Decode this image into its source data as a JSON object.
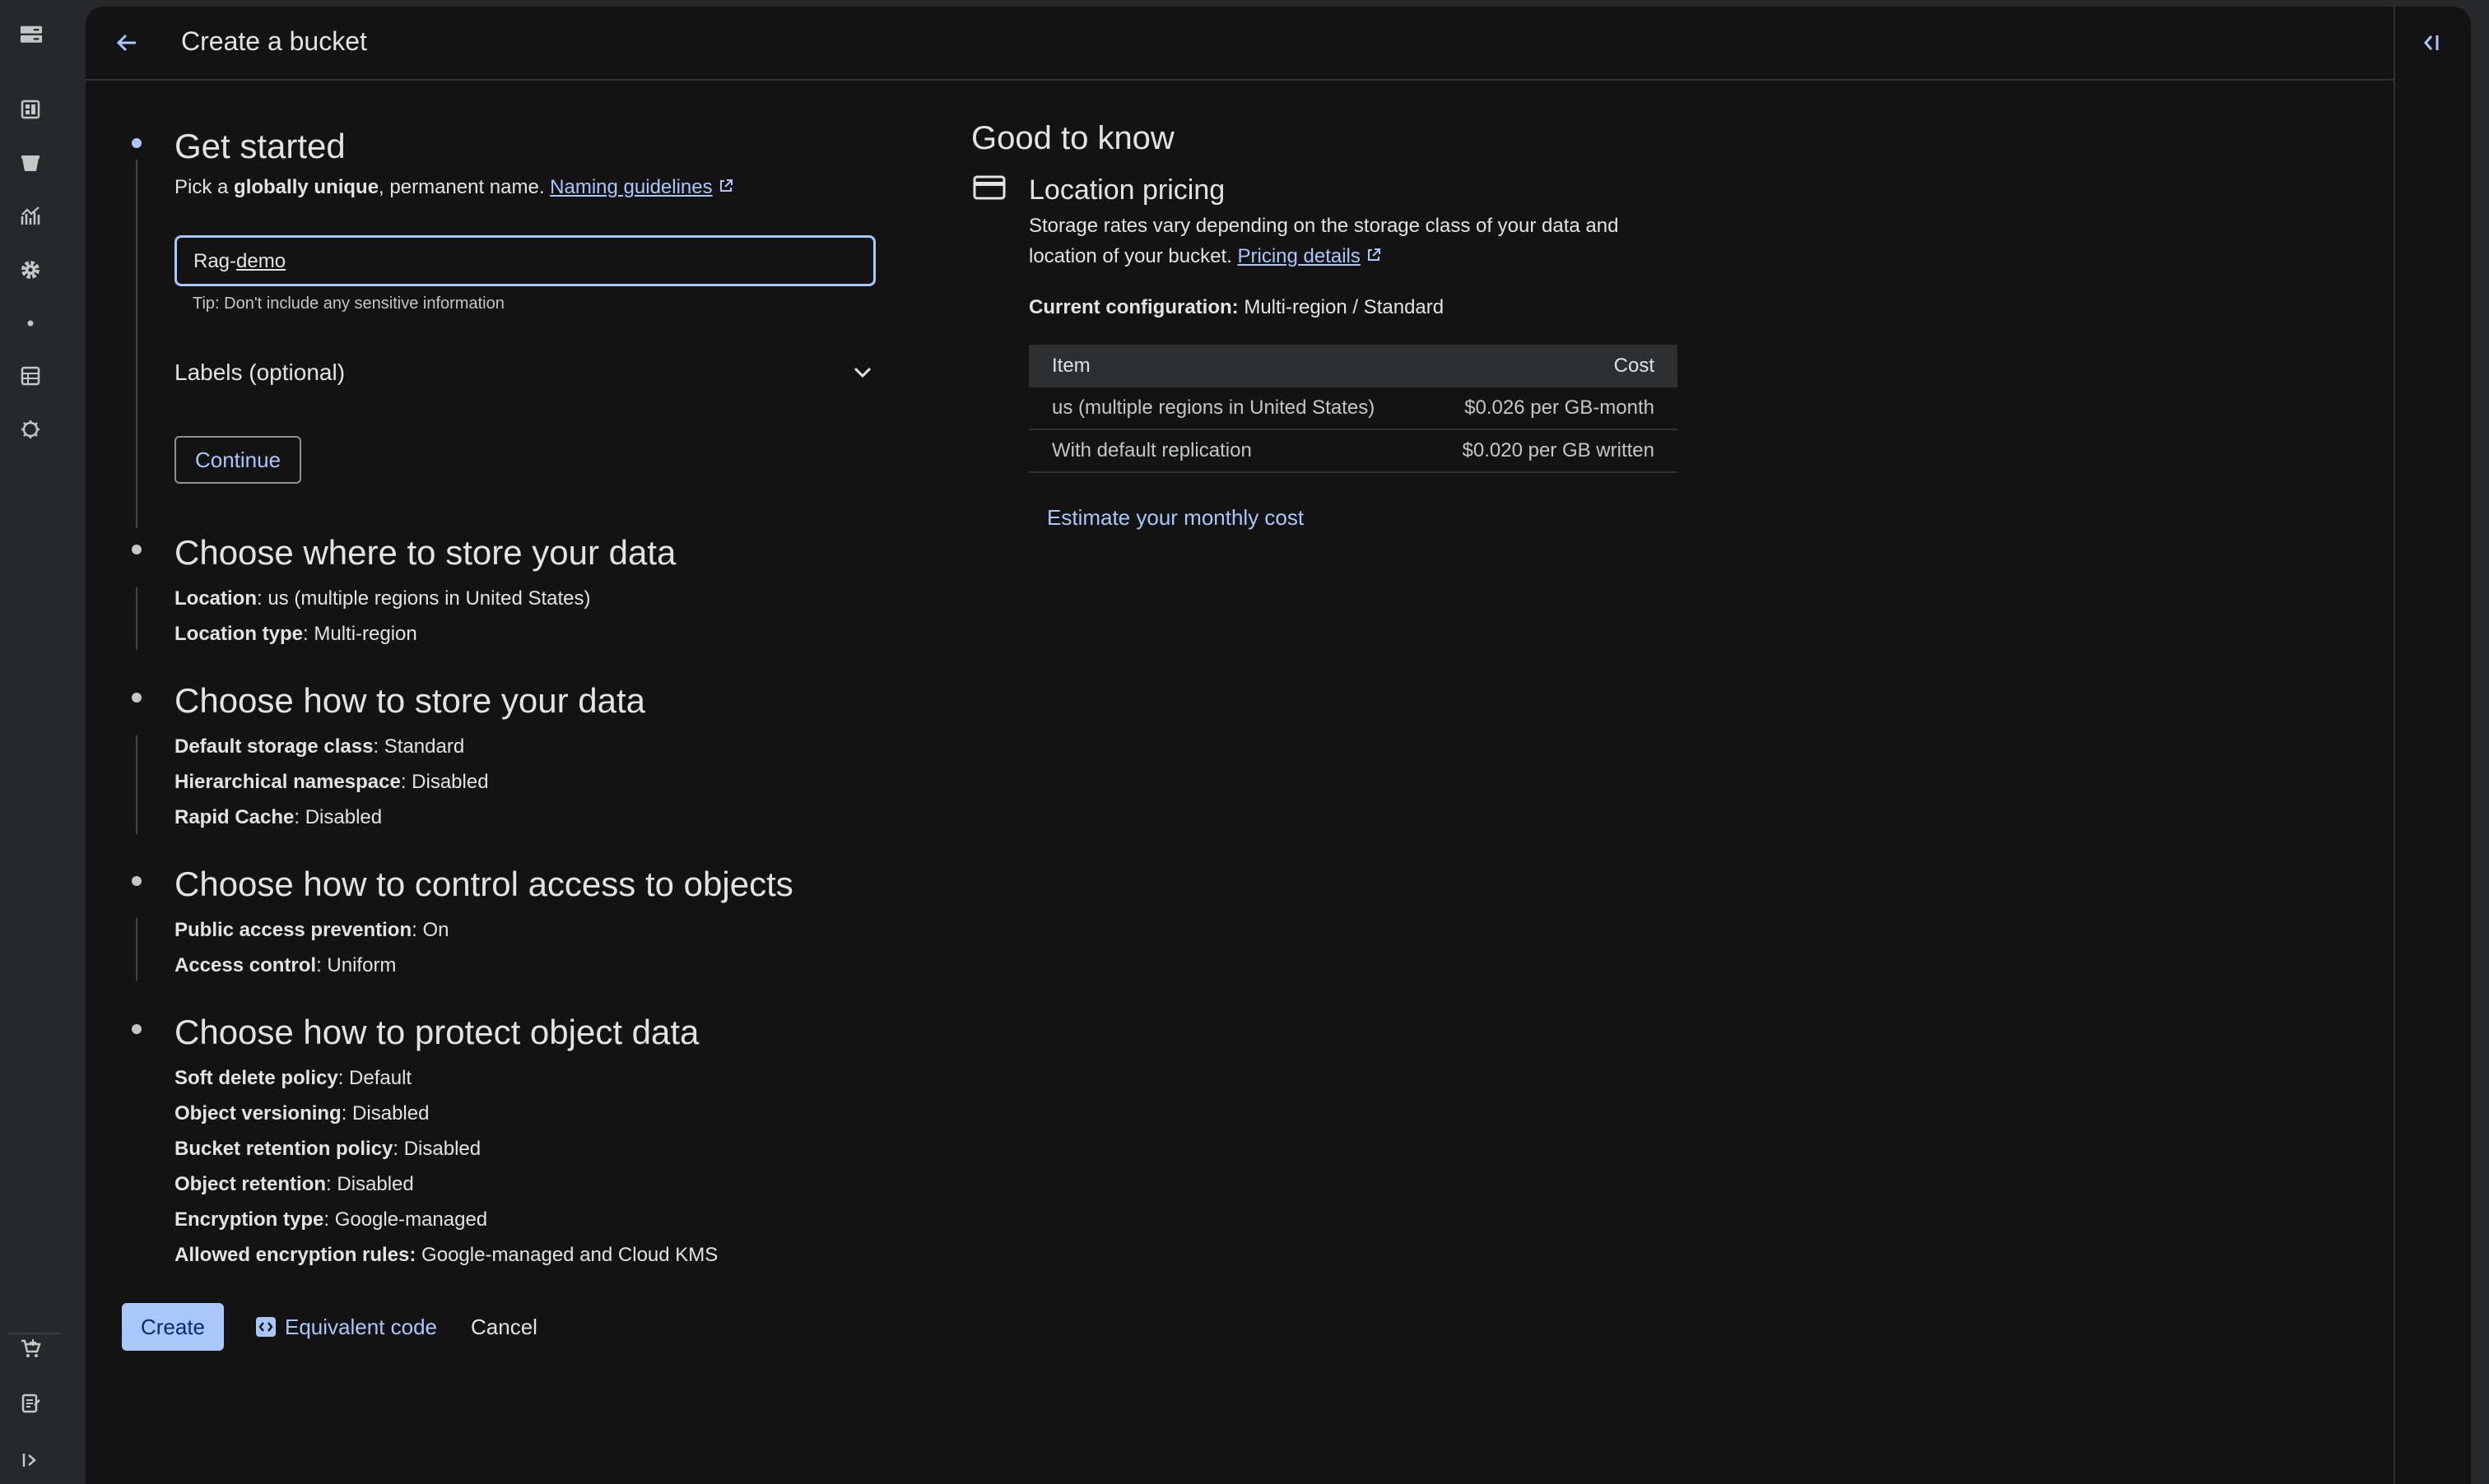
{
  "header": {
    "title": "Create a bucket"
  },
  "get_started": {
    "heading": "Get started",
    "desc_pre": "Pick a ",
    "desc_bold": "globally unique",
    "desc_post": ", permanent name. ",
    "naming_link": "Naming guidelines",
    "name_value_part1": "Rag-",
    "name_value_part2": "demo",
    "tip": "Tip: Don't include any sensitive information",
    "labels_toggle": "Labels (optional)",
    "continue_label": "Continue"
  },
  "where": {
    "heading": "Choose where to store your data",
    "location_label": "Location",
    "location_value": ": us (multiple regions in United States)",
    "type_label": "Location type",
    "type_value": ": Multi-region"
  },
  "how_store": {
    "heading": "Choose how to store your data",
    "class_label": "Default storage class",
    "class_value": ": Standard",
    "ns_label": "Hierarchical namespace",
    "ns_value": ": Disabled",
    "cache_label": "Rapid Cache",
    "cache_value": ": Disabled"
  },
  "access": {
    "heading": "Choose how to control access to objects",
    "pap_label": "Public access prevention",
    "pap_value": ": On",
    "ac_label": "Access control",
    "ac_value": ": Uniform"
  },
  "protect": {
    "heading": "Choose how to protect object data",
    "soft_label": "Soft delete policy",
    "soft_value": ": Default",
    "ver_label": "Object versioning",
    "ver_value": ": Disabled",
    "brp_label": "Bucket retention policy",
    "brp_value": ": Disabled",
    "or_label": "Object retention",
    "or_value": ": Disabled",
    "enc_label": "Encryption type",
    "enc_value": ": Google-managed",
    "aer_label": "Allowed encryption rules:",
    "aer_value": " Google-managed and Cloud KMS"
  },
  "actions": {
    "create": "Create",
    "code": "Equivalent code",
    "cancel": "Cancel"
  },
  "good_to_know": {
    "heading": "Good to know",
    "pricing_title": "Location pricing",
    "pricing_desc": "Storage rates vary depending on the storage class of your data and location of your bucket. ",
    "pricing_link": "Pricing details",
    "config_label": "Current configuration:",
    "config_value": " Multi-region / Standard",
    "table_head_item": "Item",
    "table_head_cost": "Cost",
    "row1_item": "us (multiple regions in United States)",
    "row1_cost": "$0.026 per GB-month",
    "row2_item": "With default replication",
    "row2_cost": "$0.020 per GB written",
    "estimate": "Estimate your monthly cost"
  },
  "colors": {
    "accent": "#a8c7fa",
    "background": "#131314",
    "rail": "#26282c"
  }
}
